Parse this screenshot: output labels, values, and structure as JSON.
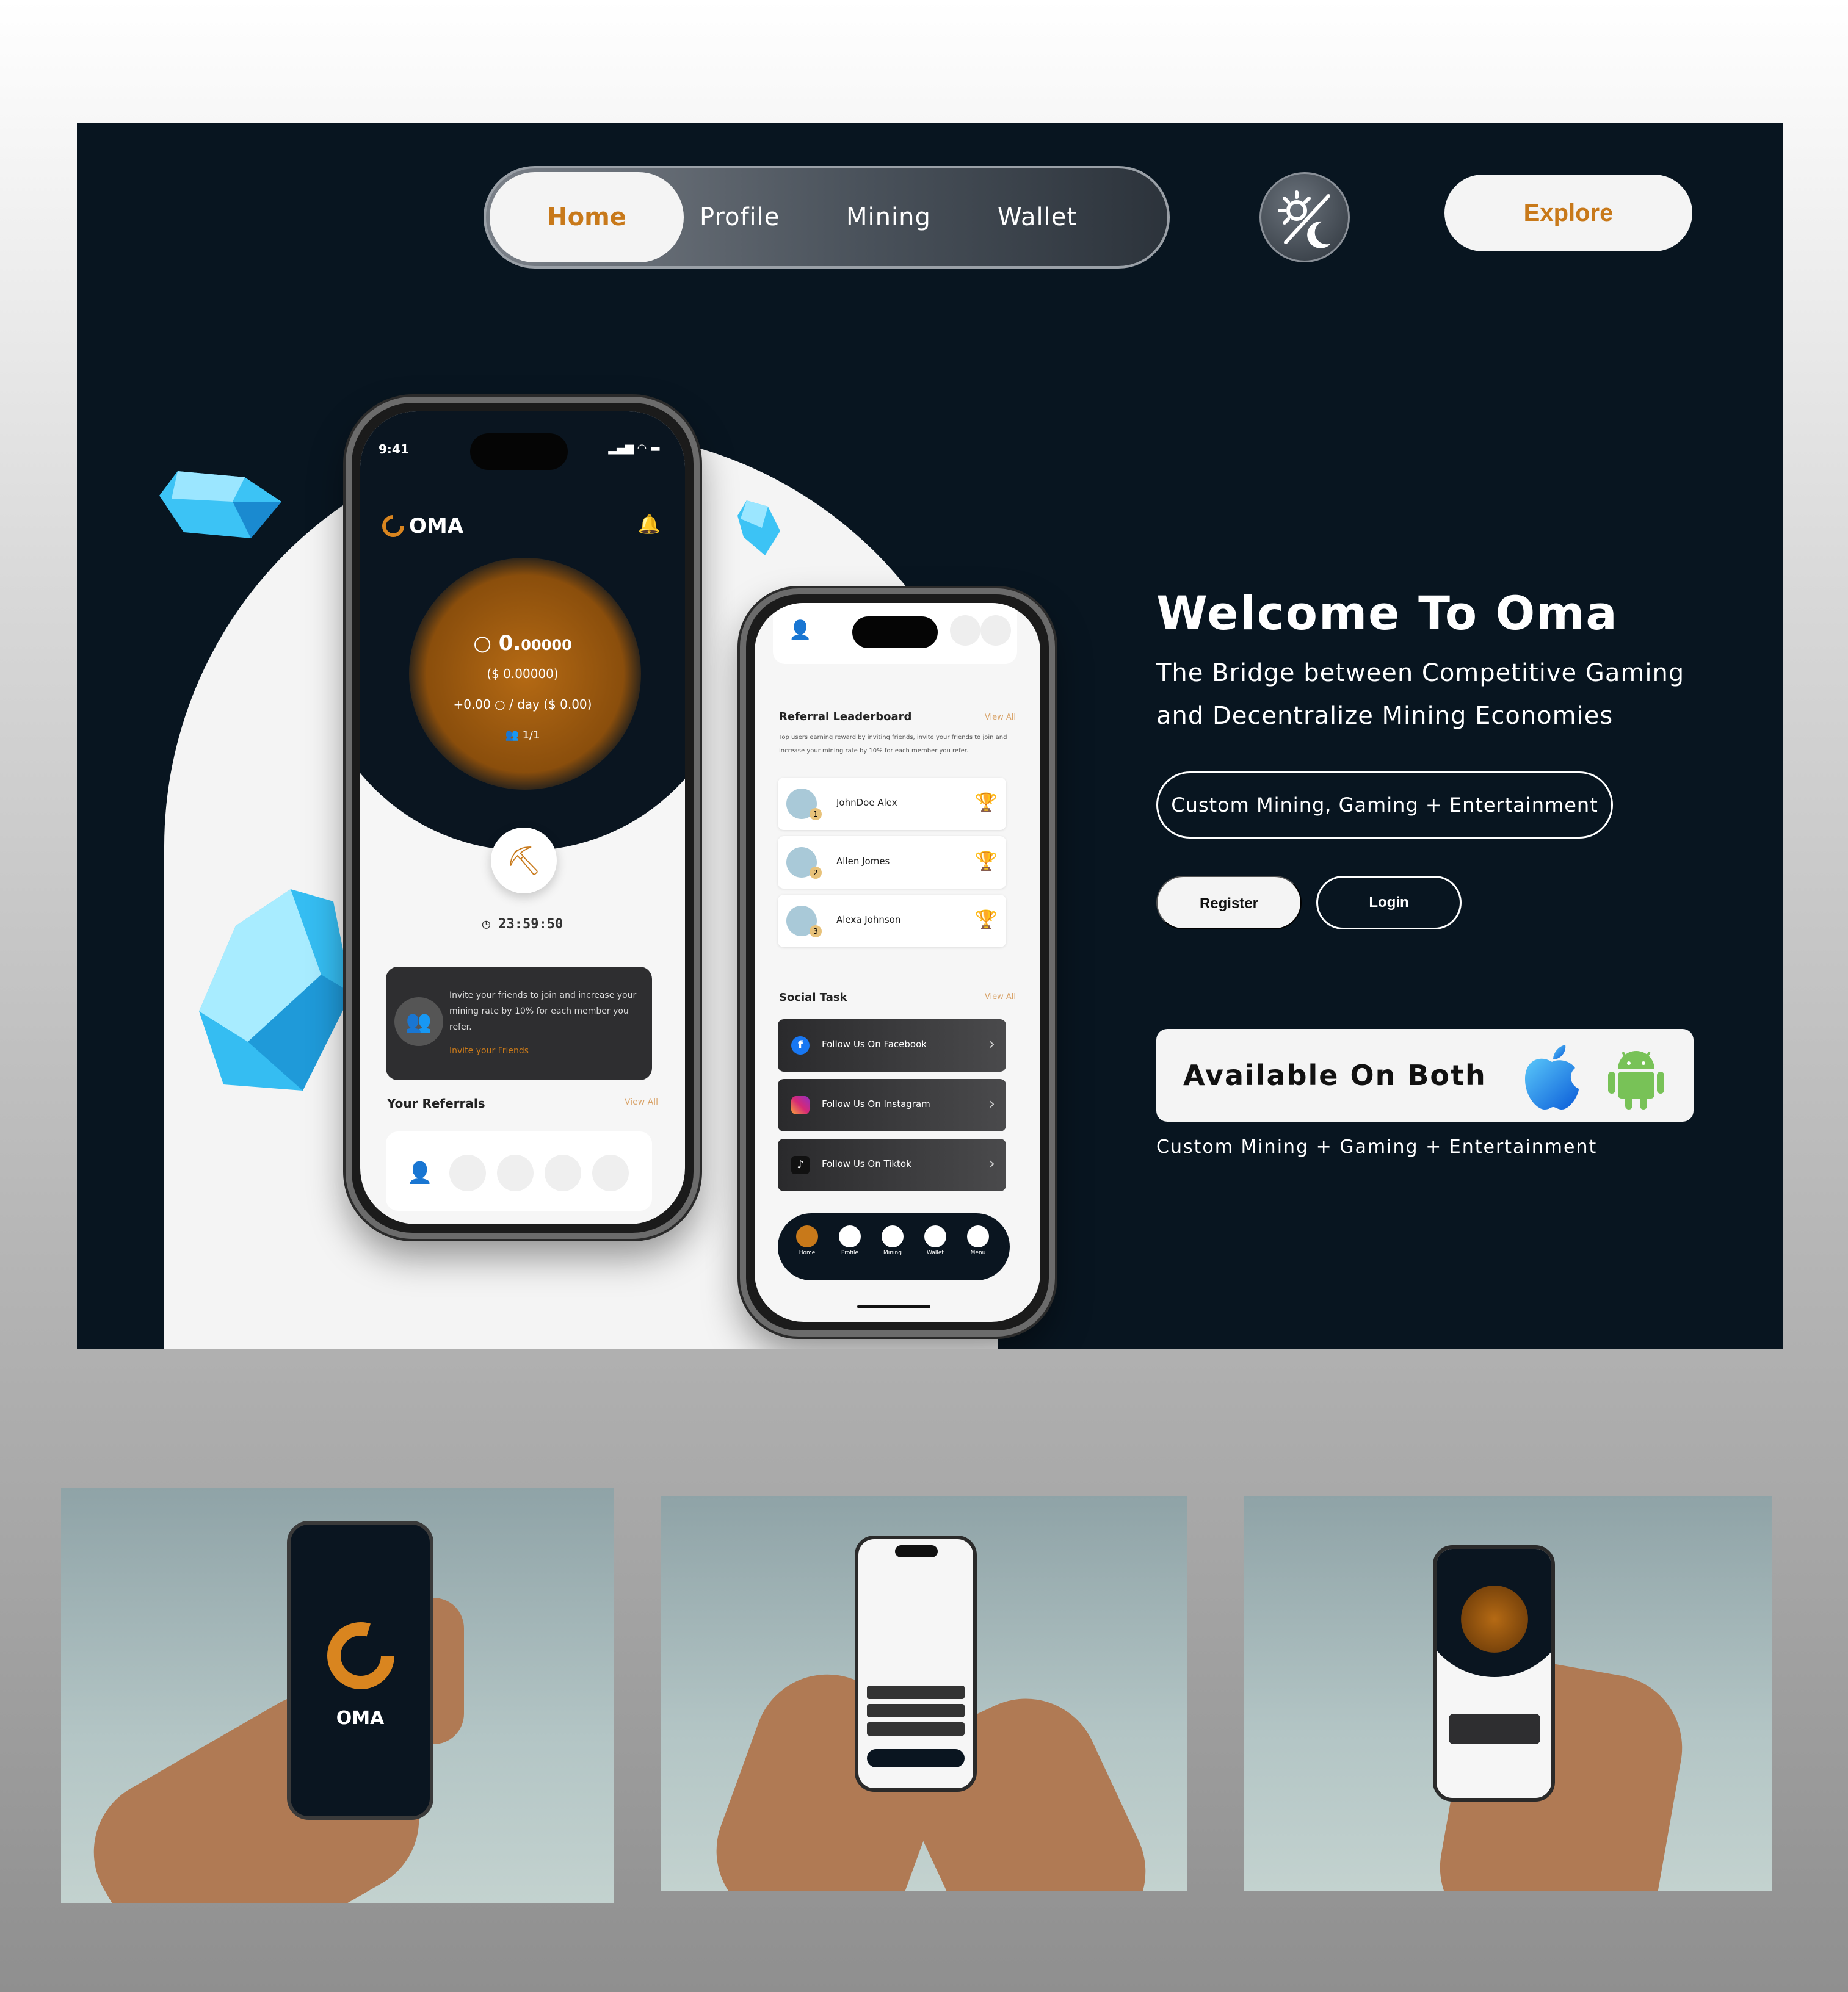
{
  "nav": {
    "items": [
      "Home",
      "Profile",
      "Mining",
      "Wallet"
    ],
    "active": "Home"
  },
  "explore_label": "Explore",
  "hero": {
    "title": "Welcome To Oma",
    "subtitle": "The Bridge between Competitive Gaming and Decentralize Mining Economies",
    "tag": "Custom Mining, Gaming + Entertainment",
    "register_label": "Register",
    "login_label": "Login",
    "available_label": "Available On Both",
    "bottom_text": "Custom Mining + Gaming + Entertainment"
  },
  "phone1": {
    "time": "9:41",
    "brand": "OMA",
    "balance": "0.00000",
    "balance_prefix": "0.",
    "balance_digits": "00000",
    "usd": "($ 0.00000)",
    "rate": "+0.00 ○ / day ($ 0.00)",
    "members": "1/1",
    "timer": "23:59:50",
    "invite_text": "Invite your friends to join and increase your mining rate by 10% for each member you refer.",
    "invite_link": "Invite your Friends",
    "referrals_title": "Your Referrals",
    "view_all": "View All"
  },
  "phone2": {
    "leaderboard_title": "Referral Leaderboard",
    "view_all": "View All",
    "leaderboard_desc": "Top users earning reward by inviting friends, invite your friends to join and increase your mining rate by 10% for each member you refer.",
    "leaders": [
      {
        "name": "JohnDoe Alex",
        "rank": "1"
      },
      {
        "name": "Allen Jomes",
        "rank": "2"
      },
      {
        "name": "Alexa Johnson",
        "rank": "3"
      }
    ],
    "social_title": "Social Task",
    "tasks": [
      "Follow Us On Facebook",
      "Follow Us On Instagram",
      "Follow Us On Tiktok"
    ],
    "tabs": [
      "Home",
      "Profile",
      "Mining",
      "Wallet",
      "Menu"
    ]
  },
  "thumb1": {
    "brand": "OMA"
  },
  "colors": {
    "accent": "#c8791a",
    "dark": "#081520",
    "light": "#f4f4f4"
  }
}
